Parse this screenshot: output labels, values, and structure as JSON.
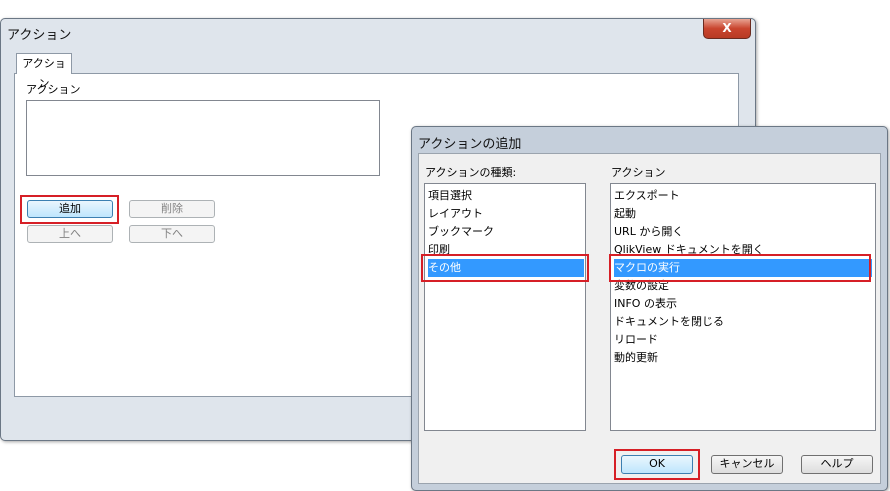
{
  "main_dialog": {
    "title": "アクション",
    "close_label": "X",
    "tab_label": "アクション",
    "actions_label": "アクション",
    "buttons": {
      "add": "追加",
      "delete": "削除",
      "up": "上へ",
      "down": "下へ"
    }
  },
  "add_dialog": {
    "title": "アクションの追加",
    "type_label": "アクションの種類:",
    "action_label": "アクション",
    "types": [
      "項目選択",
      "レイアウト",
      "ブックマーク",
      "印刷",
      "その他"
    ],
    "selected_type": "その他",
    "actions": [
      "エクスポート",
      "起動",
      "URL から開く",
      "QlikView ドキュメントを開く",
      "マクロの実行",
      "変数の設定",
      "INFO の表示",
      "ドキュメントを閉じる",
      "リロード",
      "動的更新"
    ],
    "selected_action": "マクロの実行",
    "buttons": {
      "ok": "OK",
      "cancel": "キャンセル",
      "help": "ヘルプ"
    }
  },
  "colors": {
    "highlight": "#d61f26",
    "selection": "#3399ff"
  }
}
